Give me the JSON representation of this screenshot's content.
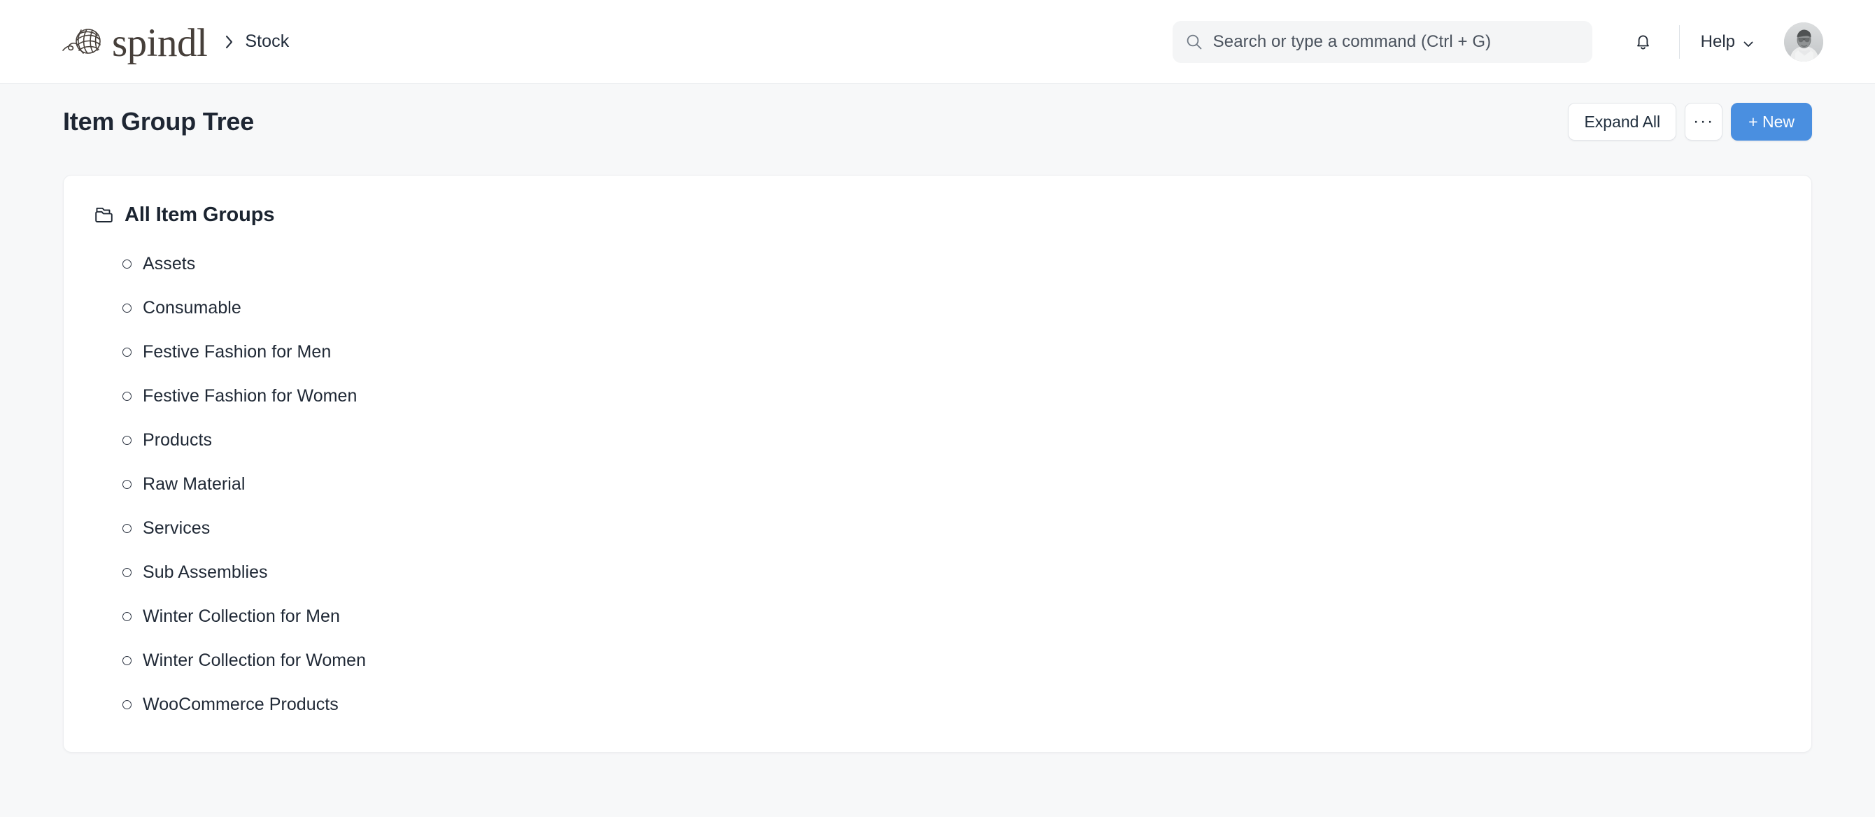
{
  "navbar": {
    "logo": {
      "icon": "yarn-ball-icon",
      "wordmark": "spindl",
      "color": "#463f3a"
    },
    "breadcrumb": {
      "separator_icon": "chevron-right-icon",
      "current": "Stock"
    },
    "search": {
      "icon": "search-icon",
      "placeholder": "Search or type a command (Ctrl + G)",
      "value": ""
    },
    "notifications": {
      "icon": "bell-icon"
    },
    "help": {
      "label": "Help",
      "icon": "chevron-down-icon"
    },
    "avatar": {
      "icon": "user-avatar",
      "alt": "User profile photo"
    }
  },
  "page": {
    "title": "Item Group Tree",
    "actions": {
      "expand_all": "Expand All",
      "more": "···",
      "new": "+ New"
    }
  },
  "tree": {
    "root": {
      "icon": "folder-icon",
      "label": "All Item Groups"
    },
    "nodes": [
      {
        "label": "Assets"
      },
      {
        "label": "Consumable"
      },
      {
        "label": "Festive Fashion for Men"
      },
      {
        "label": "Festive Fashion for Women"
      },
      {
        "label": "Products"
      },
      {
        "label": "Raw Material"
      },
      {
        "label": "Services"
      },
      {
        "label": "Sub Assemblies"
      },
      {
        "label": "Winter Collection for Men"
      },
      {
        "label": "Winter Collection for Women"
      },
      {
        "label": "WooCommerce Products"
      }
    ]
  },
  "colors": {
    "accent": "#4a8fe0",
    "page_background": "#f7f8f9",
    "card_background": "#ffffff",
    "text_primary": "#1e2633",
    "brand": "#463f3a"
  }
}
